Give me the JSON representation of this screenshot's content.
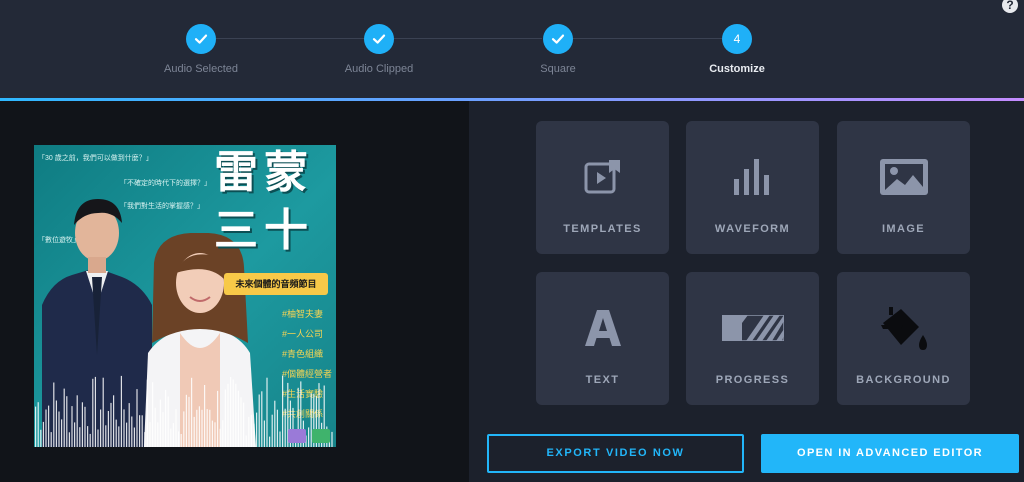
{
  "stepper": {
    "steps": [
      {
        "label": "Audio Selected",
        "state": "complete",
        "icon": "check-icon"
      },
      {
        "label": "Audio Clipped",
        "state": "complete",
        "icon": "check-icon"
      },
      {
        "label": "Square",
        "state": "complete",
        "icon": "check-icon"
      },
      {
        "label": "Customize",
        "state": "active",
        "number": "4"
      }
    ],
    "accent_color": "#1fb0f7"
  },
  "help": {
    "symbol": "?"
  },
  "cover": {
    "quotes": [
      "「30 歲之前，我們可以做到什麼？」",
      "「不確定的時代下的選擇？」",
      "「我們對生活的掌握感？」",
      "「數位遊牧」"
    ],
    "title_line1": "雷蒙",
    "title_line2": "三十",
    "tagline": "未來個體的音頻節目",
    "hashtags": [
      "#柚智夫妻",
      "#一人公司",
      "#青色組織",
      "#個體經營者",
      "#生活實驗",
      "#共創關係"
    ]
  },
  "options": [
    {
      "label": "TEMPLATES",
      "icon": "templates-icon"
    },
    {
      "label": "WAVEFORM",
      "icon": "waveform-icon"
    },
    {
      "label": "IMAGE",
      "icon": "image-icon"
    },
    {
      "label": "TEXT",
      "icon": "text-icon"
    },
    {
      "label": "PROGRESS",
      "icon": "progress-icon"
    },
    {
      "label": "BACKGROUND",
      "icon": "paint-bucket-icon"
    }
  ],
  "actions": {
    "export_label": "EXPORT VIDEO NOW",
    "advanced_label": "OPEN IN ADVANCED EDITOR"
  }
}
